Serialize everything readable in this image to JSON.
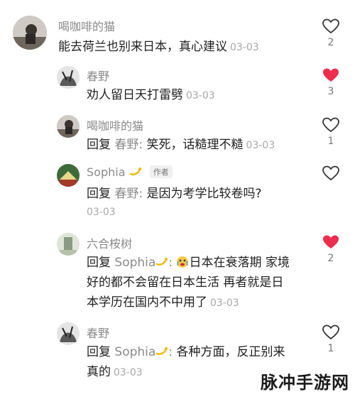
{
  "comments": [
    {
      "name": "喝咖啡的猫",
      "text": "能去荷兰也别来日本，真心建议",
      "time": "03-03",
      "likes": "2",
      "liked": false
    },
    {
      "name": "春野",
      "text": "劝人留日天打雷劈",
      "time": "03-03",
      "likes": "3",
      "liked": true
    },
    {
      "name": "喝咖啡的猫",
      "reply_prefix": "回复",
      "reply_to": "春野:",
      "text": "笑死，话糙理不糙",
      "time": "03-03",
      "likes": "1",
      "liked": false
    },
    {
      "name": "Sophia",
      "author_tag": "作者",
      "reply_prefix": "回复",
      "reply_to": "春野:",
      "text": "是因为考学比较卷吗?",
      "time": "03-03",
      "likes": "",
      "liked": false
    },
    {
      "name": "六合桉树",
      "reply_prefix": "回复",
      "reply_to": "Sophia",
      "line1": "日本在衰落期 家境",
      "line2": "好的都不会留在日本生活 再者就是日",
      "line3": "本学历在国内不中用了",
      "time": "03-03",
      "likes": "2",
      "liked": true
    },
    {
      "name": "春野",
      "reply_prefix": "回复",
      "reply_to": "Sophia",
      "line1": "各种方面，反正别来",
      "line2": "真的",
      "time": "03-03",
      "likes": "1",
      "liked": false
    }
  ],
  "watermark": "脉冲手游网",
  "colors": {
    "heart_liked": "#ee2d4c",
    "heart_outline": "#333333",
    "meta_gray": "#8a8a8a"
  }
}
